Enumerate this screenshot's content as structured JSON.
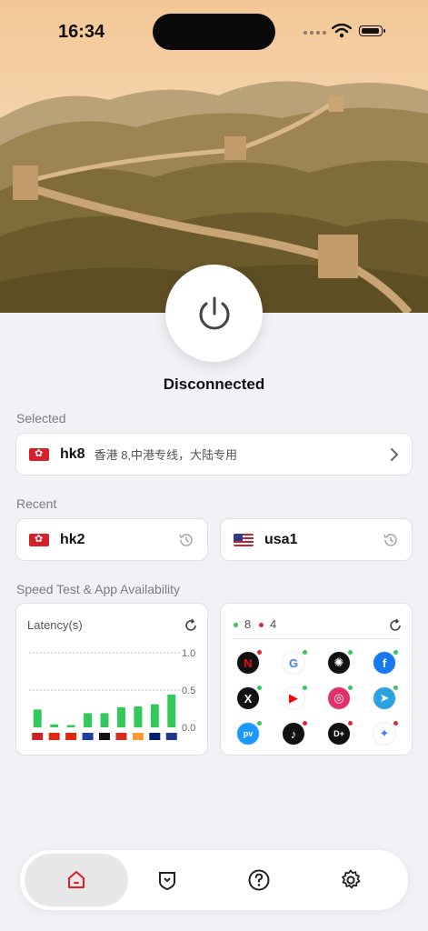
{
  "status_bar": {
    "time": "16:34"
  },
  "connection": {
    "status": "Disconnected"
  },
  "selected": {
    "section_title": "Selected",
    "server": {
      "flag": "hk-flag",
      "name": "hk8",
      "description": "香港 8,中港专线，大陆专用"
    }
  },
  "recent": {
    "section_title": "Recent",
    "servers": [
      {
        "flag": "hk-flag",
        "name": "hk2"
      },
      {
        "flag": "us-flag",
        "name": "usa1"
      }
    ]
  },
  "speed": {
    "section_title": "Speed Test & App Availability",
    "latency": {
      "title": "Latency(s)"
    },
    "availability": {
      "available_count": "8",
      "unavailable_count": "4",
      "available_color": "#34c759",
      "unavailable_color": "#e0282e"
    }
  },
  "chart_data": {
    "type": "bar",
    "title": "Latency(s)",
    "categories": [
      "US",
      "CN",
      "CN",
      "FR",
      "DE",
      "CA",
      "IN",
      "AU",
      "GB"
    ],
    "values": [
      0.24,
      0.04,
      0.03,
      0.19,
      0.19,
      0.27,
      0.28,
      0.31,
      0.44
    ],
    "ylim": [
      0,
      1.0
    ],
    "ytick_labels": [
      "1.0",
      "0.5",
      "0.0"
    ],
    "bar_color": "#34c759",
    "grid": true
  },
  "apps": [
    {
      "name": "netflix-icon",
      "status": "unavailable"
    },
    {
      "name": "google-icon",
      "status": "available"
    },
    {
      "name": "chatgpt-icon",
      "status": "available"
    },
    {
      "name": "facebook-icon",
      "status": "available"
    },
    {
      "name": "x-icon",
      "status": "available"
    },
    {
      "name": "youtube-icon",
      "status": "available"
    },
    {
      "name": "instagram-icon",
      "status": "available"
    },
    {
      "name": "telegram-icon",
      "status": "available"
    },
    {
      "name": "prime-video-icon",
      "status": "available"
    },
    {
      "name": "tiktok-icon",
      "status": "unavailable"
    },
    {
      "name": "disney-plus-icon",
      "status": "unavailable"
    },
    {
      "name": "gemini-icon",
      "status": "unavailable"
    }
  ],
  "nav": {
    "items": [
      {
        "icon": "home-icon",
        "active": true
      },
      {
        "icon": "shield-icon",
        "active": false
      },
      {
        "icon": "help-icon",
        "active": false
      },
      {
        "icon": "settings-icon",
        "active": false
      }
    ]
  }
}
